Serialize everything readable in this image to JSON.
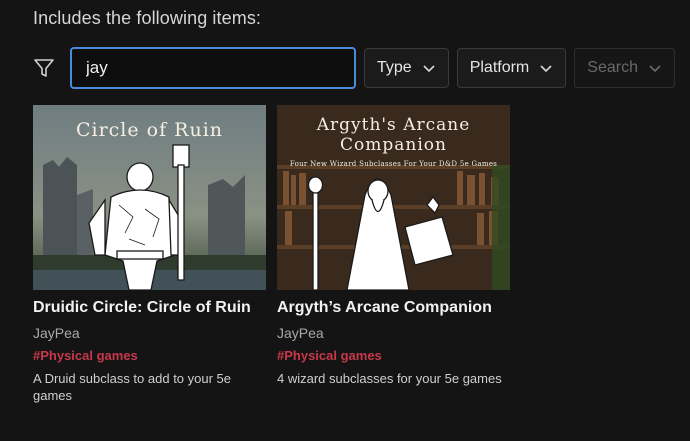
{
  "section": {
    "title": "Includes the following items:"
  },
  "filters": {
    "icon": "filter-icon",
    "search_value": "jay",
    "type_label": "Type",
    "platform_label": "Platform",
    "search_button_label": "Search"
  },
  "cards": [
    {
      "cover_title": "Circle of Ruin",
      "title": "Druidic Circle: Circle of Ruin",
      "author": "JayPea",
      "tag": "#Physical games",
      "description": "A Druid subclass to add to your 5e games"
    },
    {
      "cover_title_line1": "Argyth's Arcane",
      "cover_title_line2": "Companion",
      "cover_subtitle": "Four New Wizard Subclasses For Your D&D 5e Games",
      "title": "Argyth’s Arcane Companion",
      "author": "JayPea",
      "tag": "#Physical games",
      "description": "4 wizard subclasses for your 5e games"
    }
  ],
  "colors": {
    "background": "#141414",
    "focus_border": "#4a8bd8",
    "tag": "#c8384a"
  }
}
